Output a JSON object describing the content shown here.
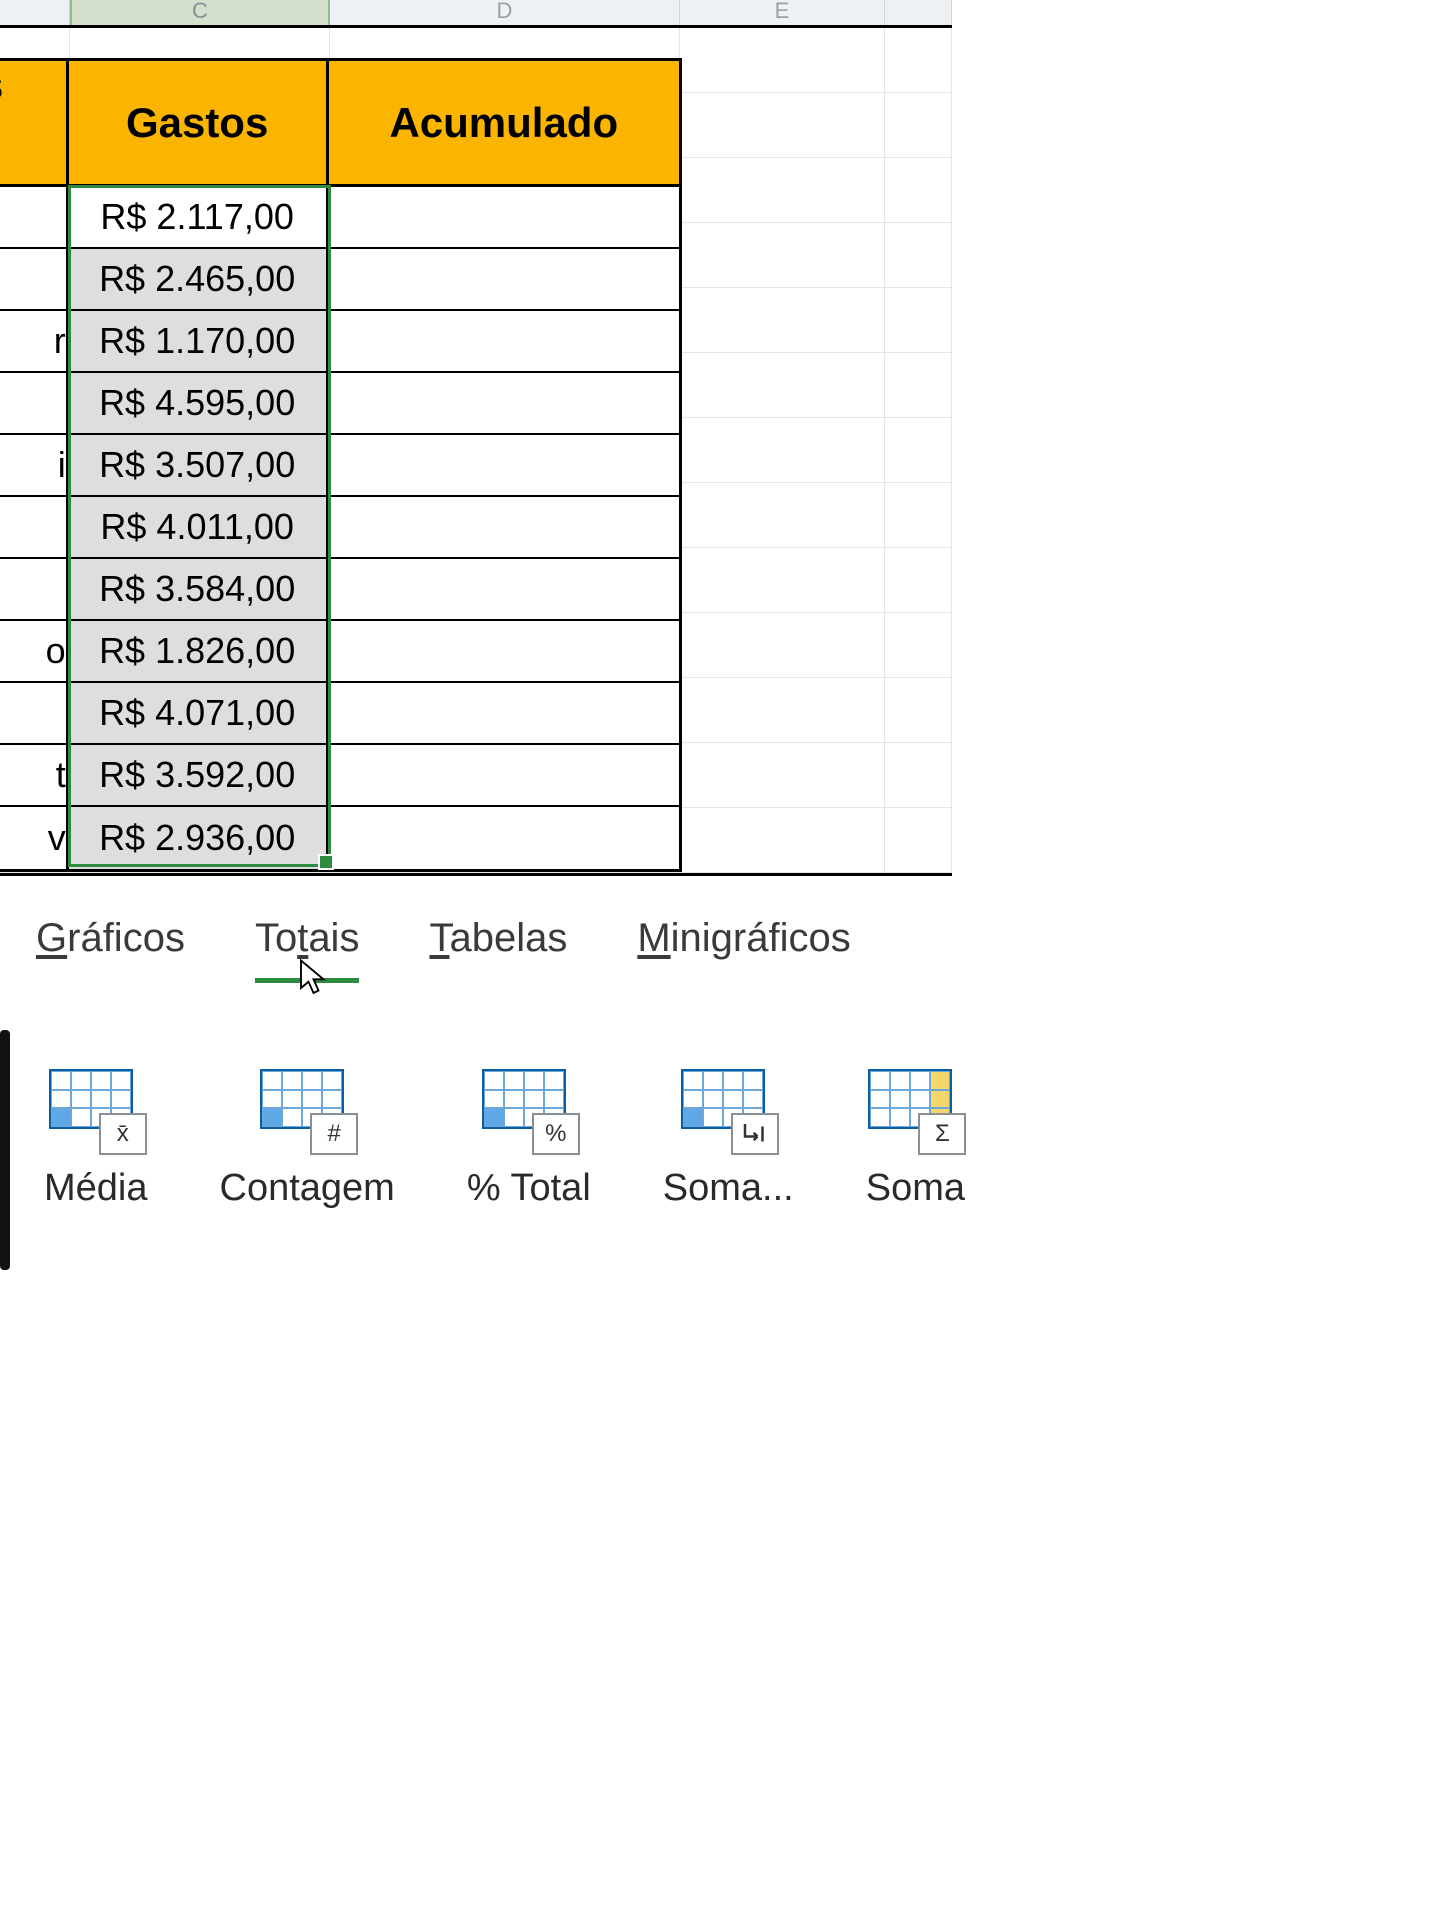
{
  "columns": {
    "c": "C",
    "d": "D",
    "e": "E"
  },
  "headers": {
    "left_fragment": "s",
    "gastos": "Gastos",
    "acumulado": "Acumulado"
  },
  "row_fragments": [
    "",
    "",
    "r",
    "",
    "i",
    "",
    "",
    "o",
    "",
    "t",
    "v"
  ],
  "gastos": [
    "R$ 2.117,00",
    "R$ 2.465,00",
    "R$ 1.170,00",
    "R$ 4.595,00",
    "R$ 3.507,00",
    "R$ 4.011,00",
    "R$ 3.584,00",
    "R$ 1.826,00",
    "R$ 4.071,00",
    "R$ 3.592,00",
    "R$ 2.936,00"
  ],
  "qa_tabs": {
    "graficos": {
      "u": "G",
      "rest": "ráficos"
    },
    "totais": {
      "pre": "To",
      "u": "t",
      "post": "ais"
    },
    "tabelas": {
      "u": "T",
      "rest": "abelas"
    },
    "minigraficos": {
      "u": "M",
      "rest": "inigráficos"
    }
  },
  "qa_options": {
    "media": {
      "label": "Média",
      "badge": "x̄"
    },
    "contagem": {
      "label": "Contagem",
      "badge": "#"
    },
    "pct_total": {
      "label": "% Total",
      "badge": "%"
    },
    "soma_running": {
      "label": "Soma...",
      "badge_svg": true
    },
    "soma": {
      "label": "Soma",
      "badge": "Σ",
      "highlight_col": true
    }
  }
}
